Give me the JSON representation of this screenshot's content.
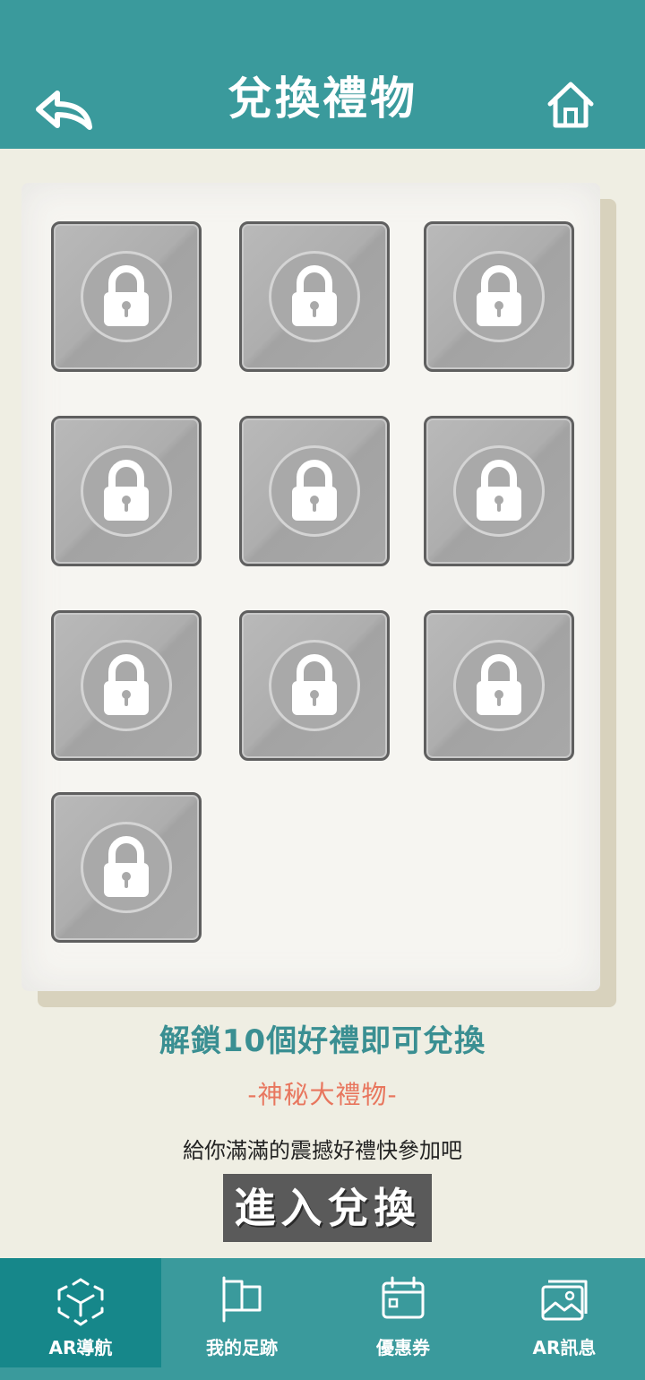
{
  "header": {
    "title": "兌換禮物",
    "back_icon": "back-arrow-icon",
    "home_icon": "home-icon",
    "background_color": "#3a9a9c"
  },
  "gifts": {
    "total": 10,
    "items": [
      {
        "status": "locked"
      },
      {
        "status": "locked"
      },
      {
        "status": "locked"
      },
      {
        "status": "locked"
      },
      {
        "status": "locked"
      },
      {
        "status": "locked"
      },
      {
        "status": "locked"
      },
      {
        "status": "locked"
      },
      {
        "status": "locked"
      },
      {
        "status": "locked"
      }
    ],
    "lock_icon": "lock-icon"
  },
  "promo": {
    "unlock_text": "解鎖10個好禮即可兌換",
    "gift_text": "-神秘大禮物-",
    "description": "給你滿滿的震撼好禮快參加吧",
    "enter_button": "進入兌換",
    "unlock_color": "#3a8f92",
    "gift_color": "#e8765e"
  },
  "bottom_nav": {
    "items": [
      {
        "label": "AR導航",
        "icon": "ar-cube-icon",
        "active": true
      },
      {
        "label": "我的足跡",
        "icon": "flag-icon",
        "active": false
      },
      {
        "label": "優惠券",
        "icon": "calendar-coupon-icon",
        "active": false
      },
      {
        "label": "AR訊息",
        "icon": "photo-gallery-icon",
        "active": false
      }
    ],
    "active_color": "#16878a"
  }
}
